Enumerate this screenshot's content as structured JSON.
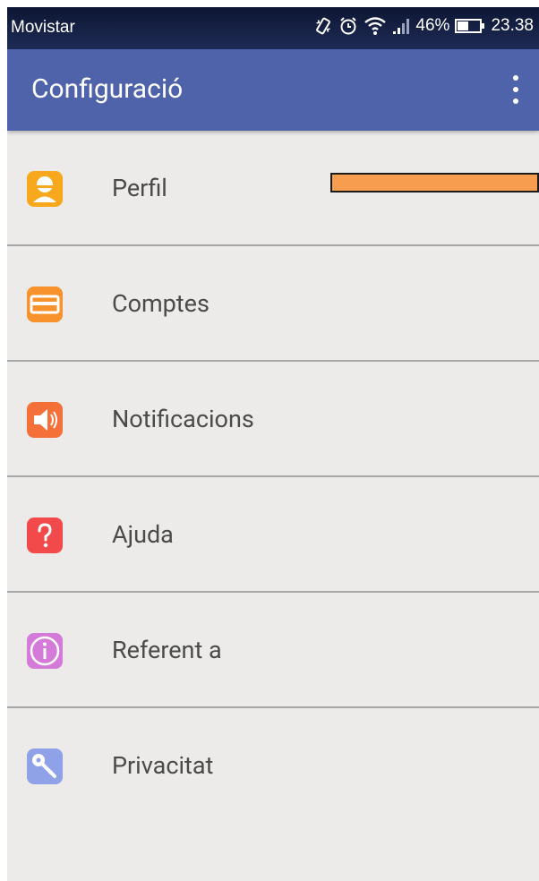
{
  "status_bar": {
    "carrier": "Movistar",
    "battery": "46%",
    "time": "23.38",
    "icons": [
      "vibrate-icon",
      "alarm-icon",
      "wifi-icon",
      "signal-icon",
      "battery-icon"
    ]
  },
  "app_bar": {
    "title": "Configuració",
    "menu_icon": "overflow-menu-icon",
    "color": "#4e63aa"
  },
  "menu": {
    "items": [
      {
        "label": "Perfil",
        "icon": "profile-icon",
        "color": "#f8a81d"
      },
      {
        "label": "Comptes",
        "icon": "accounts-icon",
        "color": "#f7922c"
      },
      {
        "label": "Notificacions",
        "icon": "notifications-icon",
        "color": "#f56f39"
      },
      {
        "label": "Ajuda",
        "icon": "help-icon",
        "color": "#f24a4b"
      },
      {
        "label": "Referent a",
        "icon": "about-icon",
        "color": "#d47ad8"
      },
      {
        "label": "Privacitat",
        "icon": "privacy-icon",
        "color": "#8fa2e8"
      }
    ]
  }
}
